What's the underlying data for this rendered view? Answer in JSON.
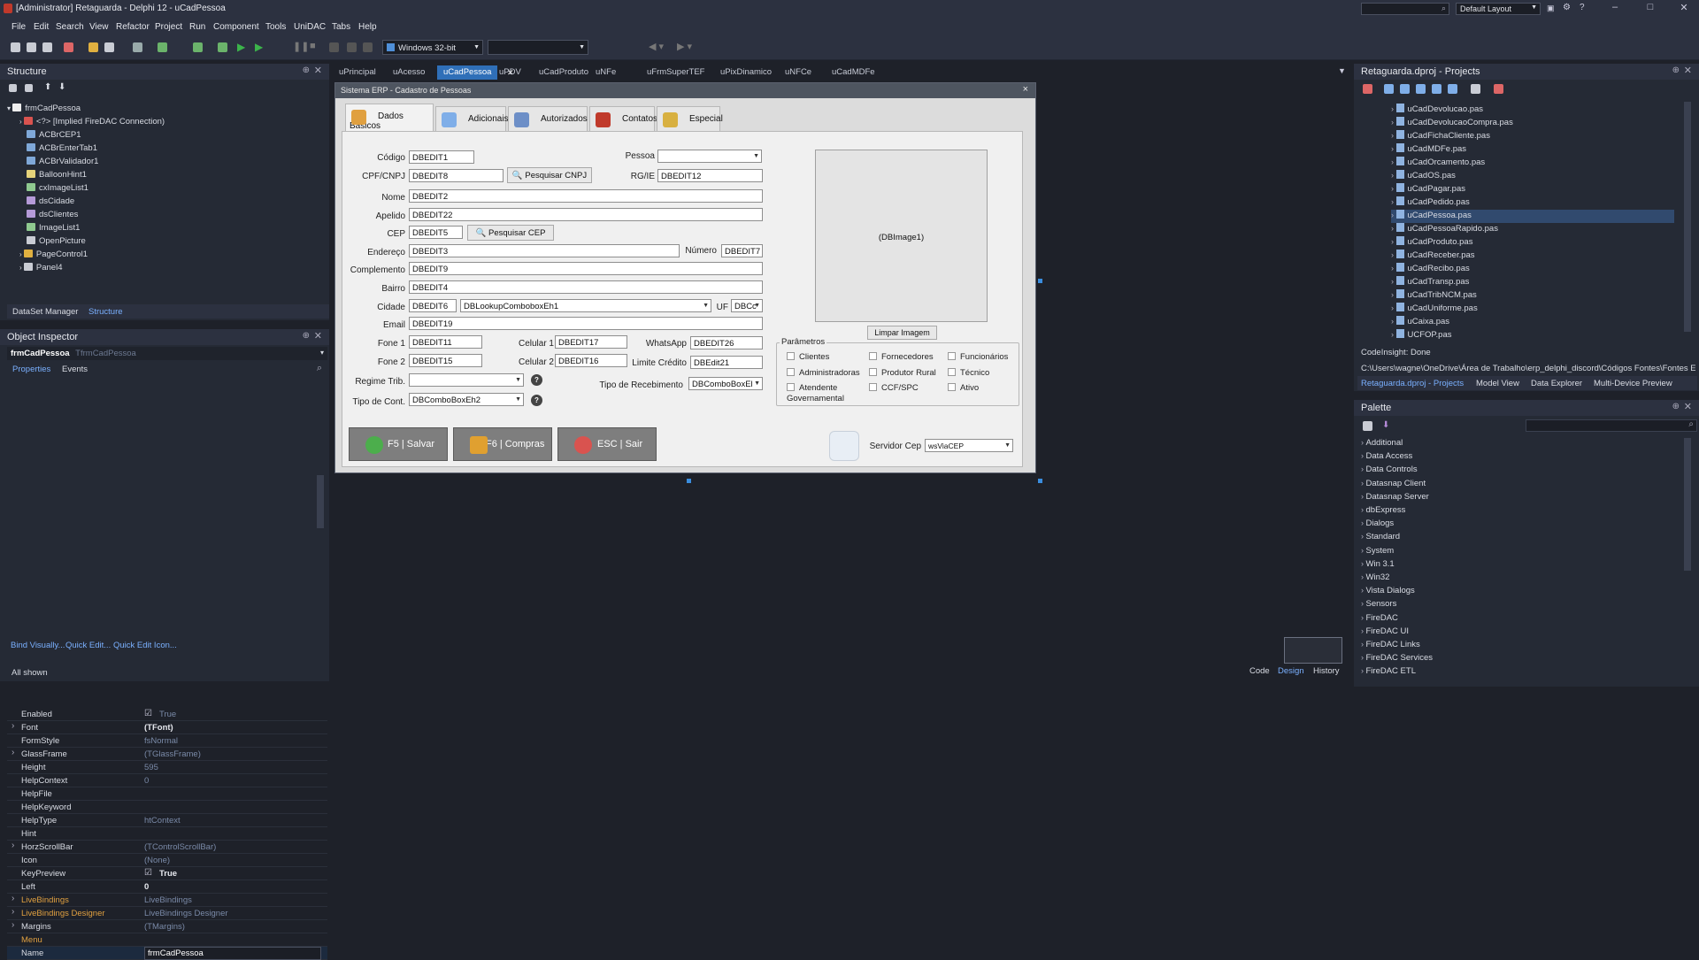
{
  "window": {
    "title": "[Administrator] Retaguarda - Delphi 12 - uCadPessoa",
    "search_value": "",
    "layout": "Default Layout"
  },
  "menu": [
    "File",
    "Edit",
    "Search",
    "View",
    "Refactor",
    "Project",
    "Run",
    "Component",
    "Tools",
    "UniDAC",
    "Tabs",
    "Help"
  ],
  "toolbar": {
    "platform": "Windows 32-bit",
    "config": ""
  },
  "editor_tabs": [
    "uPrincipal",
    "uAcesso",
    "uCadPessoa",
    "uPDV",
    "uCadProduto",
    "uNFe",
    "uFrmSuperTEF",
    "uPixDinamico",
    "uNFCe",
    "uCadMDFe"
  ],
  "structure": {
    "title": "Structure",
    "root": "frmCadPessoa",
    "items": [
      "<?> [Implied FireDAC Connection)",
      "ACBrCEP1",
      "ACBrEnterTab1",
      "ACBrValidador1",
      "BalloonHint1",
      "cxImageList1",
      "dsCidade",
      "dsClientes",
      "ImageList1",
      "OpenPicture",
      "PageControl1",
      "Panel4"
    ],
    "bottom_tabs": [
      "DataSet Manager",
      "Structure"
    ]
  },
  "object_inspector": {
    "title": "Object Inspector",
    "selected": "frmCadPessoa",
    "selected_class": "TfrmCadPessoa",
    "tabs": [
      "Properties",
      "Events"
    ],
    "rows": [
      {
        "k": "Enabled",
        "v": "True",
        "bold": false,
        "check": true
      },
      {
        "k": "Font",
        "v": "(TFont)",
        "bold": true
      },
      {
        "k": "FormStyle",
        "v": "fsNormal",
        "bold": false
      },
      {
        "k": "GlassFrame",
        "v": "(TGlassFrame)",
        "bold": false
      },
      {
        "k": "Height",
        "v": "595",
        "bold": false
      },
      {
        "k": "HelpContext",
        "v": "0",
        "bold": false
      },
      {
        "k": "HelpFile",
        "v": "",
        "bold": false
      },
      {
        "k": "HelpKeyword",
        "v": "",
        "bold": false
      },
      {
        "k": "HelpType",
        "v": "htContext",
        "bold": false
      },
      {
        "k": "Hint",
        "v": "",
        "bold": false
      },
      {
        "k": "HorzScrollBar",
        "v": "(TControlScrollBar)",
        "bold": false
      },
      {
        "k": "Icon",
        "v": "(None)",
        "bold": false
      },
      {
        "k": "KeyPreview",
        "v": "True",
        "bold": true,
        "check": true
      },
      {
        "k": "Left",
        "v": "0",
        "bold": true
      },
      {
        "k": "LiveBindings",
        "v": "LiveBindings",
        "bold": false
      },
      {
        "k": "LiveBindings Designer",
        "v": "LiveBindings Designer",
        "bold": false
      },
      {
        "k": "Margins",
        "v": "(TMargins)",
        "bold": false
      },
      {
        "k": "Menu",
        "v": "",
        "bold": false
      },
      {
        "k": "Name",
        "v": "frmCadPessoa",
        "bold": false
      }
    ],
    "links": [
      "Bind Visually...",
      "Quick Edit...",
      "Quick Edit Icon..."
    ],
    "status": "All shown"
  },
  "form": {
    "title": "Sistema ERP - Cadastro de Pessoas",
    "close": "×",
    "tabs": [
      "Dados Basicos",
      "Adicionais",
      "Autorizados",
      "Contatos",
      "Especial"
    ],
    "fields": {
      "codigo_label": "Código",
      "codigo": "DBEDIT1",
      "pessoa_label": "Pessoa",
      "pessoa": "",
      "cpf_label": "CPF/CNPJ",
      "cpf": "DBEDIT8",
      "pesq_cnpj": "Pesquisar CNPJ",
      "rg_label": "RG/IE",
      "rg": "DBEDIT12",
      "nome_label": "Nome",
      "nome": "DBEDIT2",
      "apelido_label": "Apelido",
      "apelido": "DBEDIT22",
      "cep_label": "CEP",
      "cep": "DBEDIT5",
      "pesq_cep": "Pesquisar CEP",
      "endereco_label": "Endereço",
      "endereco": "DBEDIT3",
      "numero_label": "Número",
      "numero": "DBEDIT7",
      "complemento_label": "Complemento",
      "complemento": "DBEDIT9",
      "bairro_label": "Bairro",
      "bairro": "DBEDIT4",
      "cidade_label": "Cidade",
      "cidade": "DBEDIT6",
      "cidade_lookup": "DBLookupComboboxEh1",
      "uf_label": "UF",
      "uf": "DBCc",
      "email_label": "Email",
      "email": "DBEDIT19",
      "fone1_label": "Fone 1",
      "fone1": "DBEDIT11",
      "cel1_label": "Celular 1",
      "cel1": "DBEDIT17",
      "whats_label": "WhatsApp",
      "whats": "DBEDIT26",
      "fone2_label": "Fone 2",
      "fone2": "DBEDIT15",
      "cel2_label": "Celular 2",
      "cel2": "DBEDIT16",
      "limite_label": "Limite Crédito",
      "limite": "DBEdit21",
      "regime_label": "Regime Trib.",
      "regime": "",
      "tiporec_label": "Tipo de Recebimento",
      "tiporec": "DBComboBoxEl",
      "tipocont_label": "Tipo de Cont.",
      "tipocont": "DBComboBoxEh2"
    },
    "image_placeholder": "(DBImage1)",
    "limpar_imagem": "Limpar Imagem",
    "parametros": {
      "title": "Parâmetros",
      "items": [
        "Clientes",
        "Fornecedores",
        "Funcionários",
        "Administradoras",
        "Produtor Rural",
        "Técnico",
        "Atendente Governamental",
        "CCF/SPC",
        "Ativo"
      ]
    },
    "buttons": {
      "save": "F5 | Salvar",
      "compras": "F6 | Compras",
      "exit": "ESC | Sair"
    },
    "servidor_cep_label": "Servidor Cep",
    "servidor_cep": "wsViaCEP"
  },
  "projects": {
    "title": "Retaguarda.dproj - Projects",
    "files": [
      "uCadDevolucao.pas",
      "uCadDevolucaoCompra.pas",
      "uCadFichaCliente.pas",
      "uCadMDFe.pas",
      "uCadOrcamento.pas",
      "uCadOS.pas",
      "uCadPagar.pas",
      "uCadPedido.pas",
      "uCadPessoa.pas",
      "uCadPessoaRapido.pas",
      "uCadProduto.pas",
      "uCadReceber.pas",
      "uCadRecibo.pas",
      "uCadTransp.pas",
      "uCadTribNCM.pas",
      "uCadUniforme.pas",
      "uCaixa.pas",
      "UCFOP.pas"
    ],
    "selected": "uCadPessoa.pas",
    "status": "CodeInsight: Done",
    "path": "C:\\Users\\wagne\\OneDrive\\Área de Trabalho\\erp_delphi_discord\\Códigos Fontes\\Fontes ERP ...",
    "tabs": [
      "Retaguarda.dproj - Projects",
      "Model View",
      "Data Explorer",
      "Multi-Device Preview"
    ]
  },
  "palette": {
    "title": "Palette",
    "items": [
      "Additional",
      "Data Access",
      "Data Controls",
      "Datasnap Client",
      "Datasnap Server",
      "dbExpress",
      "Dialogs",
      "Standard",
      "System",
      "Win 3.1",
      "Win32",
      "Vista Dialogs",
      "Sensors",
      "FireDAC",
      "FireDAC UI",
      "FireDAC Links",
      "FireDAC Services",
      "FireDAC ETL"
    ]
  },
  "editor_bottom_tabs": [
    "Code",
    "Design",
    "History"
  ]
}
